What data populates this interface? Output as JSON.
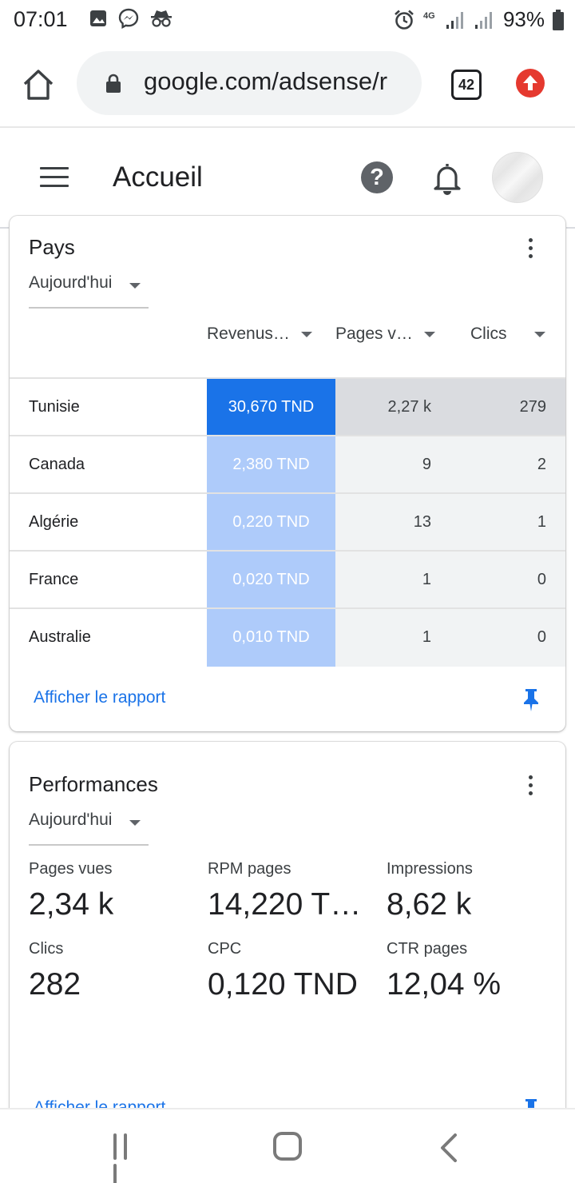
{
  "status": {
    "time": "07:01",
    "network": "4G",
    "battery": "93%"
  },
  "browser": {
    "url": "google.com/adsense/r",
    "tab_count": "42"
  },
  "app": {
    "title": "Accueil"
  },
  "pays": {
    "title": "Pays",
    "period": "Aujourd'hui",
    "columns": {
      "revenue": "Revenus…",
      "pages": "Pages v…",
      "clics": "Clics"
    },
    "rows": [
      {
        "country": "Tunisie",
        "revenue": "30,670 TND",
        "pages": "2,27 k",
        "clics": "279"
      },
      {
        "country": "Canada",
        "revenue": "2,380 TND",
        "pages": "9",
        "clics": "2"
      },
      {
        "country": "Algérie",
        "revenue": "0,220 TND",
        "pages": "13",
        "clics": "1"
      },
      {
        "country": "France",
        "revenue": "0,020 TND",
        "pages": "1",
        "clics": "0"
      },
      {
        "country": "Australie",
        "revenue": "0,010 TND",
        "pages": "1",
        "clics": "0"
      }
    ],
    "link": "Afficher le rapport"
  },
  "performances": {
    "title": "Performances",
    "period": "Aujourd'hui",
    "metrics": [
      {
        "label": "Pages vues",
        "value": "2,34 k"
      },
      {
        "label": "RPM pages",
        "value": "14,220 T…"
      },
      {
        "label": "Impressions",
        "value": "8,62 k"
      },
      {
        "label": "Clics",
        "value": "282"
      },
      {
        "label": "CPC",
        "value": "0,120 TND"
      },
      {
        "label": "CTR pages",
        "value": "12,04 %"
      }
    ],
    "link": "Afficher le rapport"
  },
  "colors": {
    "accent_blue": "#1a73e8",
    "highlight_revenue": "#1a73e8",
    "revenue_light": "#aecbfa",
    "highlight_row": "#dadce0",
    "row_tint": "#f1f3f4",
    "update_red": "#e5392f"
  }
}
